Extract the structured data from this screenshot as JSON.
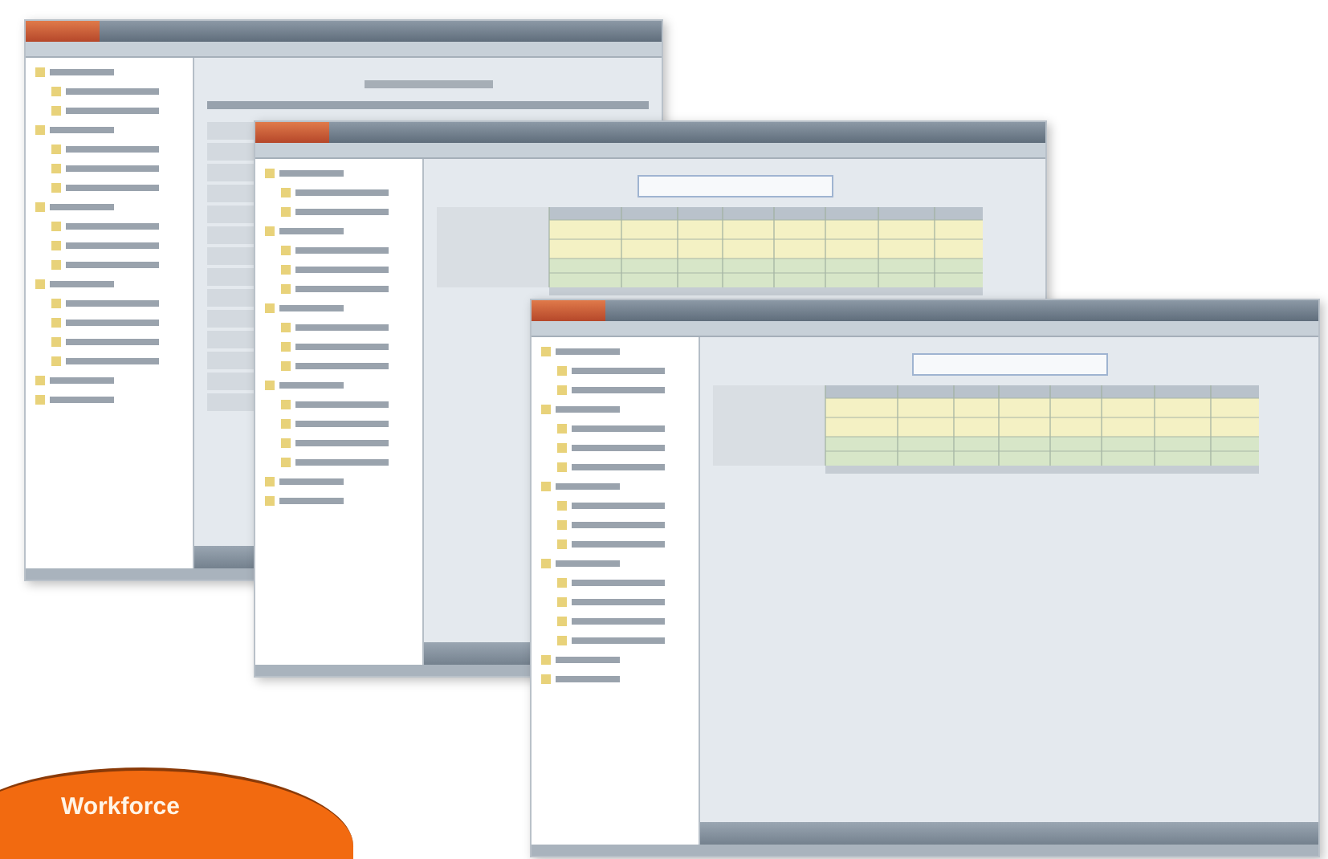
{
  "windows": [
    {
      "kind": "list"
    },
    {
      "kind": "grid"
    },
    {
      "kind": "grid"
    }
  ],
  "badge": {
    "label": "Workforce"
  }
}
